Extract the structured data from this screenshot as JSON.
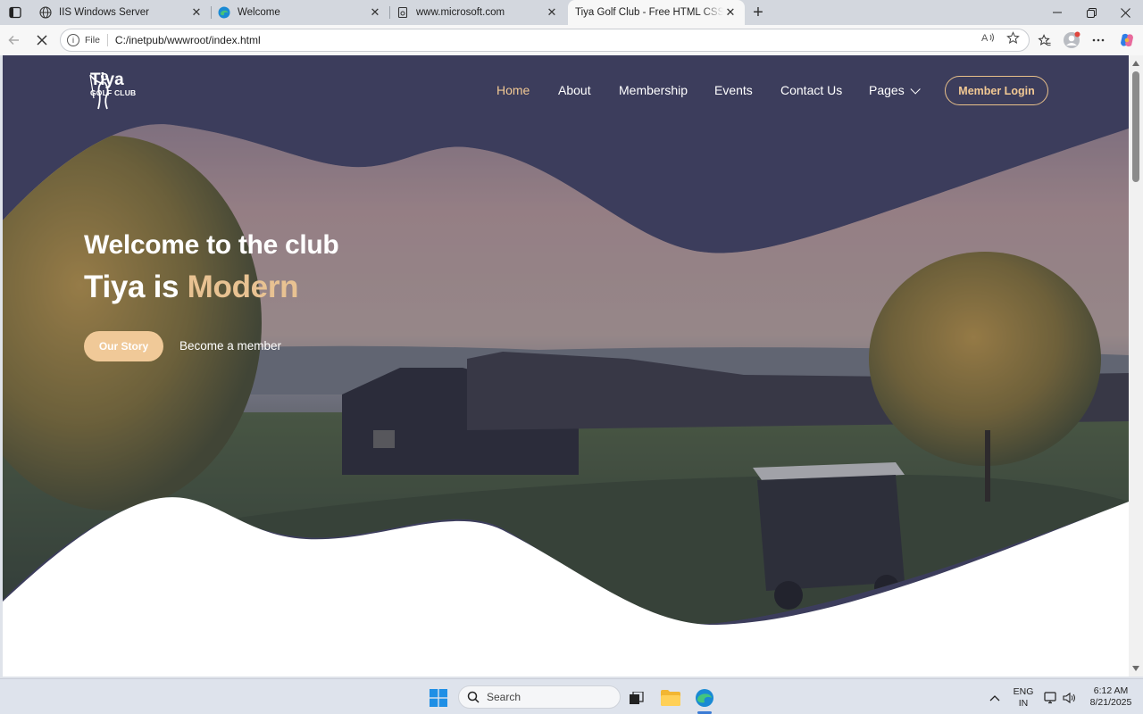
{
  "browser": {
    "tabs": [
      {
        "title": "IIS Windows Server",
        "icon": "globe-icon",
        "active": false
      },
      {
        "title": "Welcome",
        "icon": "edge-icon",
        "active": false
      },
      {
        "title": "www.microsoft.com",
        "icon": "page-icon",
        "active": false
      },
      {
        "title": "Tiya Golf Club - Free HTML CSS Te",
        "icon": "none",
        "active": true
      }
    ],
    "address": {
      "scheme_label": "File",
      "url": "C:/inetpub/wwwroot/index.html"
    }
  },
  "site": {
    "logo": {
      "name": "Tiya",
      "subtitle": "GOLF CLUB"
    },
    "menu": [
      {
        "label": "Home",
        "active": true
      },
      {
        "label": "About",
        "active": false
      },
      {
        "label": "Membership",
        "active": false
      },
      {
        "label": "Events",
        "active": false
      },
      {
        "label": "Contact Us",
        "active": false
      },
      {
        "label": "Pages",
        "active": false,
        "dropdown": true
      }
    ],
    "login_button": "Member Login",
    "hero": {
      "heading": "Welcome to the club",
      "subheading_prefix": "Tiya is ",
      "subheading_accent": "Modern",
      "primary_button": "Our Story",
      "secondary_link": "Become a member"
    },
    "colors": {
      "navy": "#3c3d5c",
      "gold": "#f0c998",
      "white": "#ffffff"
    }
  },
  "taskbar": {
    "search_placeholder": "Search",
    "language": {
      "line1": "ENG",
      "line2": "IN"
    },
    "clock": {
      "time": "6:12 AM",
      "date": "8/21/2025"
    }
  }
}
